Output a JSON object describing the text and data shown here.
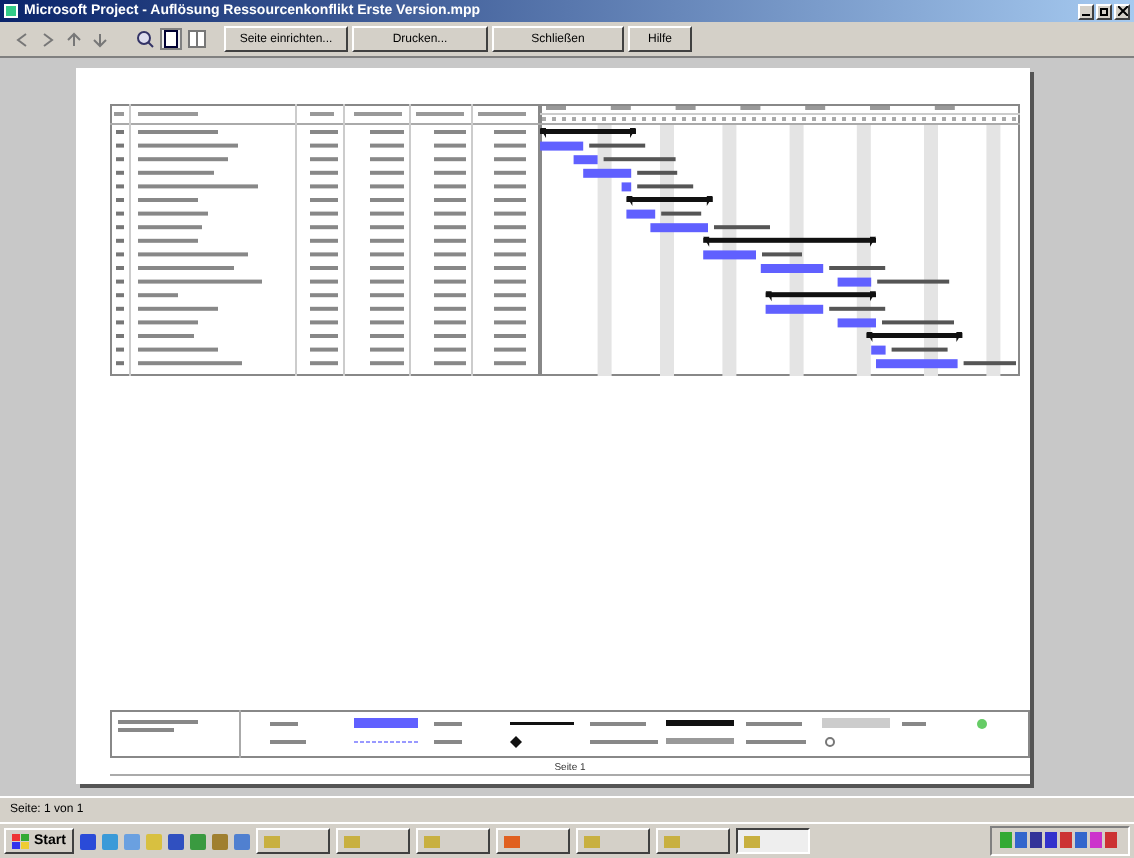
{
  "window": {
    "title": "Microsoft Project - Auflösung Ressourcenkonflikt Erste Version.mpp"
  },
  "toolbar": {
    "buttons": [
      "Seite einrichten...",
      "Drucken...",
      "Schließen",
      "Hilfe"
    ]
  },
  "page": {
    "footer": "Seite 1"
  },
  "status_bar": {
    "text": "Seite: 1 von 1"
  },
  "taskbar": {
    "start": "Start"
  }
}
